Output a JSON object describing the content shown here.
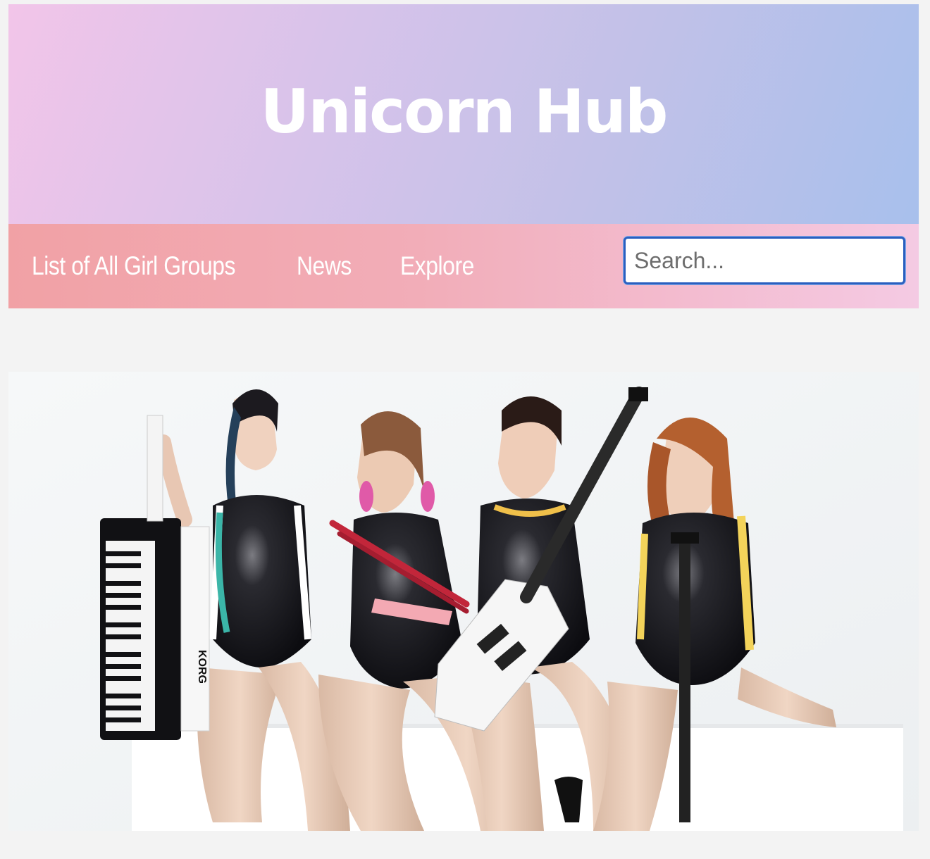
{
  "header": {
    "title": "Unicorn Hub"
  },
  "nav": {
    "links": [
      {
        "label": "List of All Girl Groups"
      },
      {
        "label": "News"
      },
      {
        "label": "Explore"
      }
    ],
    "search": {
      "placeholder": "Search..."
    }
  },
  "banner": {
    "alt": "Four-member girl group with keytar, drumsticks, guitar and bass",
    "keytar_brand": "KORG"
  },
  "colors": {
    "header_gradient": [
      "#f2c5e9",
      "#a8c0ec"
    ],
    "nav_gradient": [
      "#f1a1a5",
      "#f4cae3"
    ],
    "page_background": "#f3f3f3",
    "search_border": "#2a5fbf"
  }
}
